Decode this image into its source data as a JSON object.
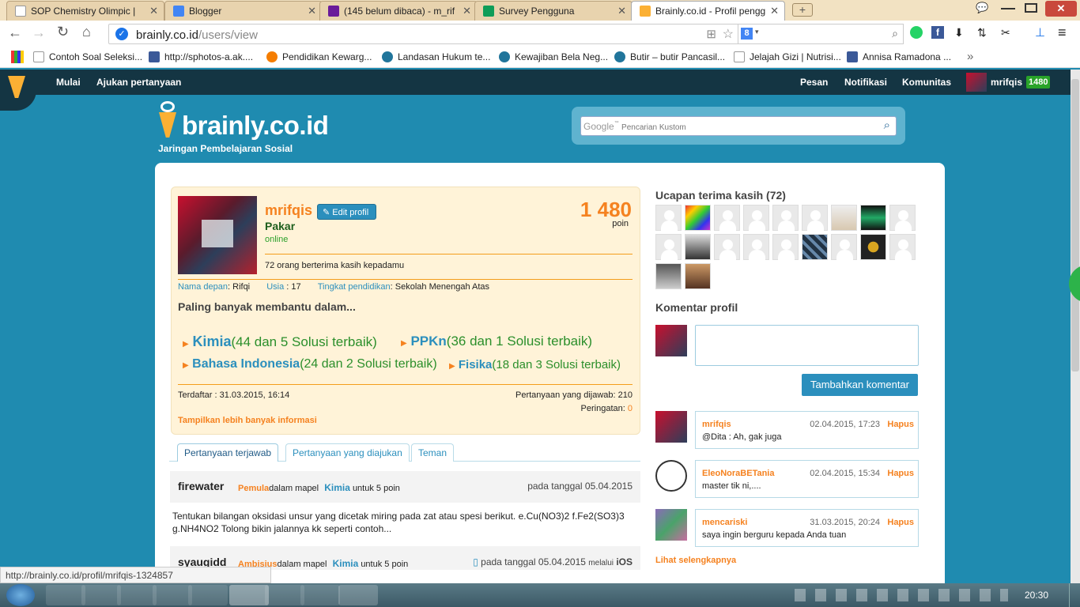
{
  "browser": {
    "tabs": [
      {
        "title": "SOP Chemistry Olimpic |",
        "color": "#ffffff"
      },
      {
        "title": "Blogger",
        "color": "#4285f4"
      },
      {
        "title": "(145 belum dibaca) - m_rif",
        "color": "#6a1b9a"
      },
      {
        "title": "Survey Pengguna",
        "color": "#0f9d58"
      },
      {
        "title": "Brainly.co.id - Profil pengg",
        "color": "#fbb034"
      }
    ],
    "url_host": "brainly.co.id",
    "url_path": "/users/view",
    "search_engine": "8",
    "bookmarks": [
      {
        "label": "Contoh Soal Seleksi...",
        "icon": "page-icon"
      },
      {
        "label": "http://sphotos-a.ak....",
        "icon": "facebook-icon"
      },
      {
        "label": "Pendidikan Kewarg...",
        "icon": "blogger-icon"
      },
      {
        "label": "Landasan Hukum te...",
        "icon": "wordpress-icon"
      },
      {
        "label": "Kewajiban Bela Neg...",
        "icon": "wordpress-icon"
      },
      {
        "label": "Butir – butir Pancasil...",
        "icon": "wordpress-icon"
      },
      {
        "label": "Jelajah Gizi | Nutrisi...",
        "icon": "page-icon"
      },
      {
        "label": "Annisa Ramadona ...",
        "icon": "facebook-icon"
      }
    ],
    "status_url": "http://brainly.co.id/profil/mrifqis-1324857"
  },
  "site": {
    "nav_left": [
      "Mulai",
      "Ajukan pertanyaan"
    ],
    "nav_right": [
      "Pesan",
      "Notifikasi",
      "Komunitas"
    ],
    "user_name": "mrifqis",
    "user_points": "1480",
    "brand": "brainly.co.id",
    "brand_sub": "Jaringan Pembelajaran Sosial",
    "search_brand": "Google",
    "search_tm": "™",
    "search_placeholder": "Pencarian Kustom"
  },
  "profile": {
    "username": "mrifqis",
    "edit_label": "Edit profil",
    "rank": "Pakar",
    "status": "online",
    "points": "1 480",
    "points_label": "poin",
    "thanks_text": "72 orang berterima kasih kepadamu",
    "first_name_label": "Nama depan",
    "first_name": "Rifqi",
    "age_label": "Usia",
    "age": "17",
    "education_label": "Tingkat pendidikan",
    "education": "Sekolah Menengah Atas",
    "most_helped_title": "Paling banyak membantu dalam...",
    "subjects": [
      {
        "name": "Kimia",
        "detail_pre": "(44 dan ",
        "best": "5",
        "detail_post": " Solusi terbaik)"
      },
      {
        "name": "PPKn",
        "detail_pre": "(36 dan ",
        "best": "1",
        "detail_post": " Solusi terbaik)"
      },
      {
        "name": "Bahasa Indonesia",
        "detail_pre": "(24 dan ",
        "best": "2",
        "detail_post": " Solusi terbaik)"
      },
      {
        "name": "Fisika",
        "detail_pre": "(18 dan ",
        "best": "3",
        "detail_post": " Solusi terbaik)"
      }
    ],
    "registered": "Terdaftar : 31.03.2015, 16:14",
    "answered": "Pertanyaan yang dijawab: 210",
    "warnings_label": "Peringatan:",
    "warnings": "0",
    "more_info": "Tampilkan lebih banyak informasi"
  },
  "tabs": [
    "Pertanyaan terjawab",
    "Pertanyaan yang diajukan",
    "Teman"
  ],
  "questions": [
    {
      "user": "firewater",
      "rank": "Pemula",
      "in_subject": "dalam mapel",
      "subject": "Kimia",
      "for": "untuk",
      "points": "5 poin",
      "date": "pada tanggal 05.04.2015",
      "via": "",
      "device": "",
      "text": "Tentukan bilangan oksidasi unsur yang dicetak miring pada zat atau spesi berikut. e.Cu(NO3)2 f.Fe2(SO3)3 g.NH4NO2 Tolong bikin jalannya kk seperti contoh..."
    },
    {
      "user": "syaugidd",
      "rank": "Ambisius",
      "in_subject": "dalam mapel",
      "subject": "Kimia",
      "for": "untuk",
      "points": "5 poin",
      "date": "pada tanggal 05.04.2015",
      "via": "melalui",
      "device": "iOS",
      "text": ""
    }
  ],
  "thanks": {
    "title": "Ucapan terima kasih (72)"
  },
  "comments_section": {
    "title": "Komentar profil",
    "add_button": "Tambahkan komentar",
    "delete_label": "Hapus",
    "see_more": "Lihat selengkapnya",
    "items": [
      {
        "user": "mrifqis",
        "date": "02.04.2015, 17:23",
        "text": "@Dita : Ah, gak juga"
      },
      {
        "user": "EleoNoraBETania",
        "date": "02.04.2015, 15:34",
        "text": "master tik ni,...."
      },
      {
        "user": "mencariski",
        "date": "31.03.2015, 20:24",
        "text": "saya ingin berguru kepada Anda tuan"
      }
    ]
  },
  "taskbar": {
    "clock": "20:30"
  }
}
